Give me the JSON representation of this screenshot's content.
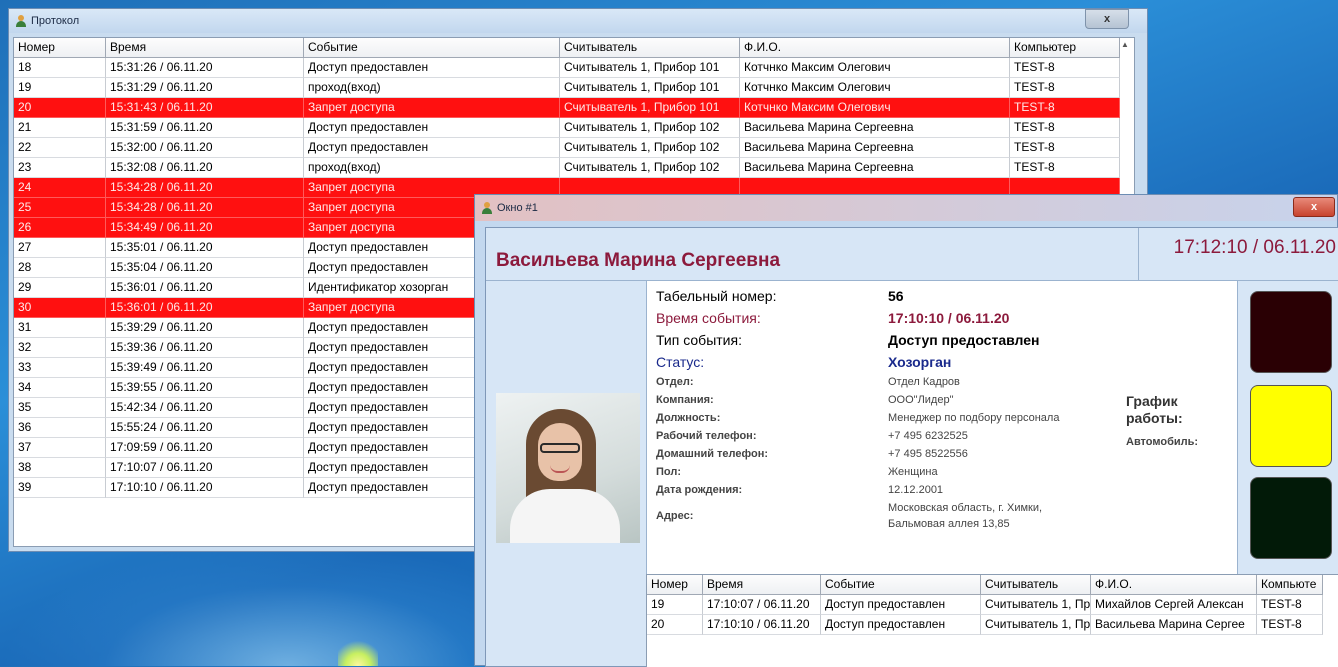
{
  "protocol_window": {
    "title": "Протокол",
    "close_label": "x",
    "columns": [
      "Номер",
      "Время",
      "Событие",
      "Считыватель",
      "Ф.И.О.",
      "Компьютер"
    ],
    "rows": [
      {
        "num": "18",
        "time": "15:31:26 / 06.11.20",
        "event": "Доступ предоставлен",
        "reader": "Считыватель 1, Прибор 101",
        "fio": "Котчнко Максим Олегович",
        "comp": "TEST-8",
        "denied": false
      },
      {
        "num": "19",
        "time": "15:31:29 / 06.11.20",
        "event": "проход(вход)",
        "reader": "Считыватель 1, Прибор 101",
        "fio": "Котчнко Максим Олегович",
        "comp": "TEST-8",
        "denied": false
      },
      {
        "num": "20",
        "time": "15:31:43 / 06.11.20",
        "event": "Запрет доступа",
        "reader": "Считыватель 1, Прибор 101",
        "fio": "Котчнко Максим Олегович",
        "comp": "TEST-8",
        "denied": true
      },
      {
        "num": "21",
        "time": "15:31:59 / 06.11.20",
        "event": "Доступ предоставлен",
        "reader": "Считыватель 1, Прибор 102",
        "fio": "Васильева Марина Сергеевна",
        "comp": "TEST-8",
        "denied": false
      },
      {
        "num": "22",
        "time": "15:32:00 / 06.11.20",
        "event": "Доступ предоставлен",
        "reader": "Считыватель 1, Прибор 102",
        "fio": "Васильева Марина Сергеевна",
        "comp": "TEST-8",
        "denied": false
      },
      {
        "num": "23",
        "time": "15:32:08 / 06.11.20",
        "event": "проход(вход)",
        "reader": "Считыватель 1, Прибор 102",
        "fio": "Васильева Марина Сергеевна",
        "comp": "TEST-8",
        "denied": false
      },
      {
        "num": "24",
        "time": "15:34:28 / 06.11.20",
        "event": "Запрет доступа",
        "reader": "",
        "fio": "",
        "comp": "",
        "denied": true
      },
      {
        "num": "25",
        "time": "15:34:28 / 06.11.20",
        "event": "Запрет доступа",
        "reader": "",
        "fio": "",
        "comp": "",
        "denied": true
      },
      {
        "num": "26",
        "time": "15:34:49 / 06.11.20",
        "event": "Запрет доступа",
        "reader": "",
        "fio": "",
        "comp": "",
        "denied": true
      },
      {
        "num": "27",
        "time": "15:35:01 / 06.11.20",
        "event": "Доступ предоставлен",
        "reader": "",
        "fio": "",
        "comp": "",
        "denied": false
      },
      {
        "num": "28",
        "time": "15:35:04 / 06.11.20",
        "event": "Доступ предоставлен",
        "reader": "",
        "fio": "",
        "comp": "",
        "denied": false
      },
      {
        "num": "29",
        "time": "15:36:01 / 06.11.20",
        "event": "Идентификатор хозорган",
        "reader": "",
        "fio": "",
        "comp": "",
        "denied": false
      },
      {
        "num": "30",
        "time": "15:36:01 / 06.11.20",
        "event": "Запрет доступа",
        "reader": "",
        "fio": "",
        "comp": "",
        "denied": true
      },
      {
        "num": "31",
        "time": "15:39:29 / 06.11.20",
        "event": "Доступ предоставлен",
        "reader": "",
        "fio": "",
        "comp": "",
        "denied": false
      },
      {
        "num": "32",
        "time": "15:39:36 / 06.11.20",
        "event": "Доступ предоставлен",
        "reader": "",
        "fio": "",
        "comp": "",
        "denied": false
      },
      {
        "num": "33",
        "time": "15:39:49 / 06.11.20",
        "event": "Доступ предоставлен",
        "reader": "",
        "fio": "",
        "comp": "",
        "denied": false
      },
      {
        "num": "34",
        "time": "15:39:55 / 06.11.20",
        "event": "Доступ предоставлен",
        "reader": "",
        "fio": "",
        "comp": "",
        "denied": false
      },
      {
        "num": "35",
        "time": "15:42:34 / 06.11.20",
        "event": "Доступ предоставлен",
        "reader": "",
        "fio": "",
        "comp": "",
        "denied": false
      },
      {
        "num": "36",
        "time": "15:55:24 / 06.11.20",
        "event": "Доступ предоставлен",
        "reader": "",
        "fio": "",
        "comp": "",
        "denied": false
      },
      {
        "num": "37",
        "time": "17:09:59 / 06.11.20",
        "event": "Доступ предоставлен",
        "reader": "",
        "fio": "",
        "comp": "",
        "denied": false
      },
      {
        "num": "38",
        "time": "17:10:07 / 06.11.20",
        "event": "Доступ предоставлен",
        "reader": "",
        "fio": "",
        "comp": "",
        "denied": false
      },
      {
        "num": "39",
        "time": "17:10:10 / 06.11.20",
        "event": "Доступ предоставлен",
        "reader": "",
        "fio": "",
        "comp": "",
        "denied": false
      }
    ]
  },
  "event_window": {
    "title": "Окно #1",
    "close_label": "x",
    "person_name": "Васильева Марина Сергеевна",
    "event_datetime": "17:12:10  /  06.11.20",
    "fields": {
      "tab_label": "Табельный номер:",
      "tab_value": "56",
      "time_label": "Время события:",
      "time_value": "17:10:10 / 06.11.20",
      "type_label": "Тип события:",
      "type_value": "Доступ предоставлен",
      "status_label": "Статус:",
      "status_value": "Хозорган",
      "dept_label": "Отдел:",
      "dept_value": "Отдел Кадров",
      "company_label": "Компания:",
      "company_value": "ООО\"Лидер\"",
      "position_label": "Должность:",
      "position_value": "Менеджер по подбору персонала",
      "work_phone_label": "Рабочий телефон:",
      "work_phone_value": "+7 495 6232525",
      "home_phone_label": "Домашний телефон:",
      "home_phone_value": "+7 495 8522556",
      "gender_label": "Пол:",
      "gender_value": "Женщина",
      "birth_label": "Дата рождения:",
      "birth_value": "12.12.2001",
      "address_label": "Адрес:",
      "address_line1": "Московская область, г. Химки,",
      "address_line2": "Бальмовая аллея 13,85"
    },
    "schedule_line1": "График",
    "schedule_line2": "работы:",
    "car_label": "Автомобиль:",
    "lamps": [
      {
        "name": "lamp-top",
        "color": "#2a0004"
      },
      {
        "name": "lamp-middle",
        "color": "#ffff00"
      },
      {
        "name": "lamp-bottom",
        "color": "#021a08"
      }
    ],
    "columns": [
      "Номер",
      "Время",
      "Событие",
      "Считыватель",
      "Ф.И.О.",
      "Компьюте"
    ],
    "rows": [
      {
        "num": "19",
        "time": "17:10:07 / 06.11.20",
        "event": "Доступ предоставлен",
        "reader": "Считыватель 1, Пр",
        "fio": "Михайлов Сергей Алексан",
        "comp": "TEST-8"
      },
      {
        "num": "20",
        "time": "17:10:10 / 06.11.20",
        "event": "Доступ предоставлен",
        "reader": "Считыватель 1, Пр",
        "fio": "Васильева Марина Сергее",
        "comp": "TEST-8"
      }
    ]
  }
}
